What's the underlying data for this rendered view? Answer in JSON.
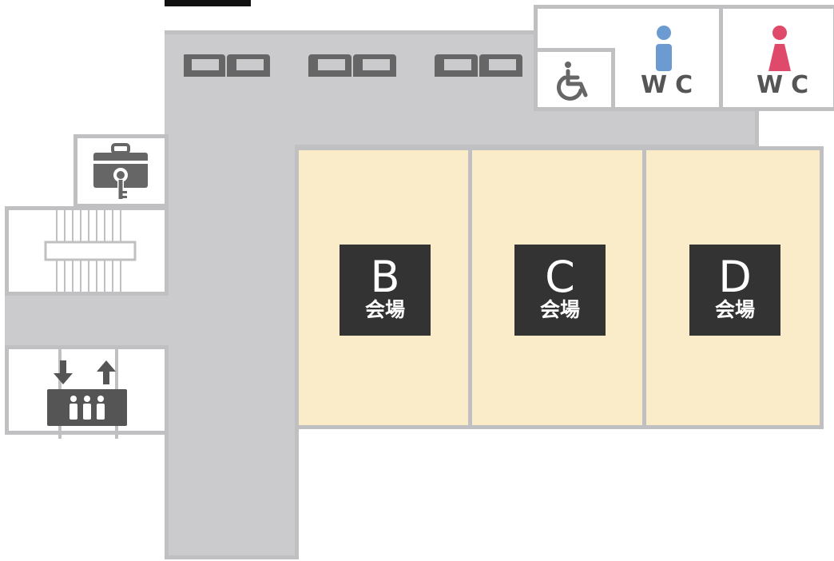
{
  "halls": [
    {
      "letter": "B",
      "suffix": "会場"
    },
    {
      "letter": "C",
      "suffix": "会場"
    },
    {
      "letter": "D",
      "suffix": "会場"
    }
  ],
  "restrooms": {
    "men_label": "WC",
    "women_label": "WC"
  },
  "icons": {
    "sofa": "sofa-icon",
    "accessible": "wheelchair-icon",
    "men": "man-icon",
    "women": "woman-icon",
    "locker": "locker-key-icon",
    "stairs": "stairs-icon",
    "elevator": "elevator-icon"
  },
  "colors": {
    "corridor": "#cbcbcd",
    "hall_fill": "#faecc9",
    "wall": "#c0c0c2",
    "plate": "#333333",
    "icon": "#666666",
    "men": "#6b9bd0",
    "women": "#e04a6a"
  }
}
